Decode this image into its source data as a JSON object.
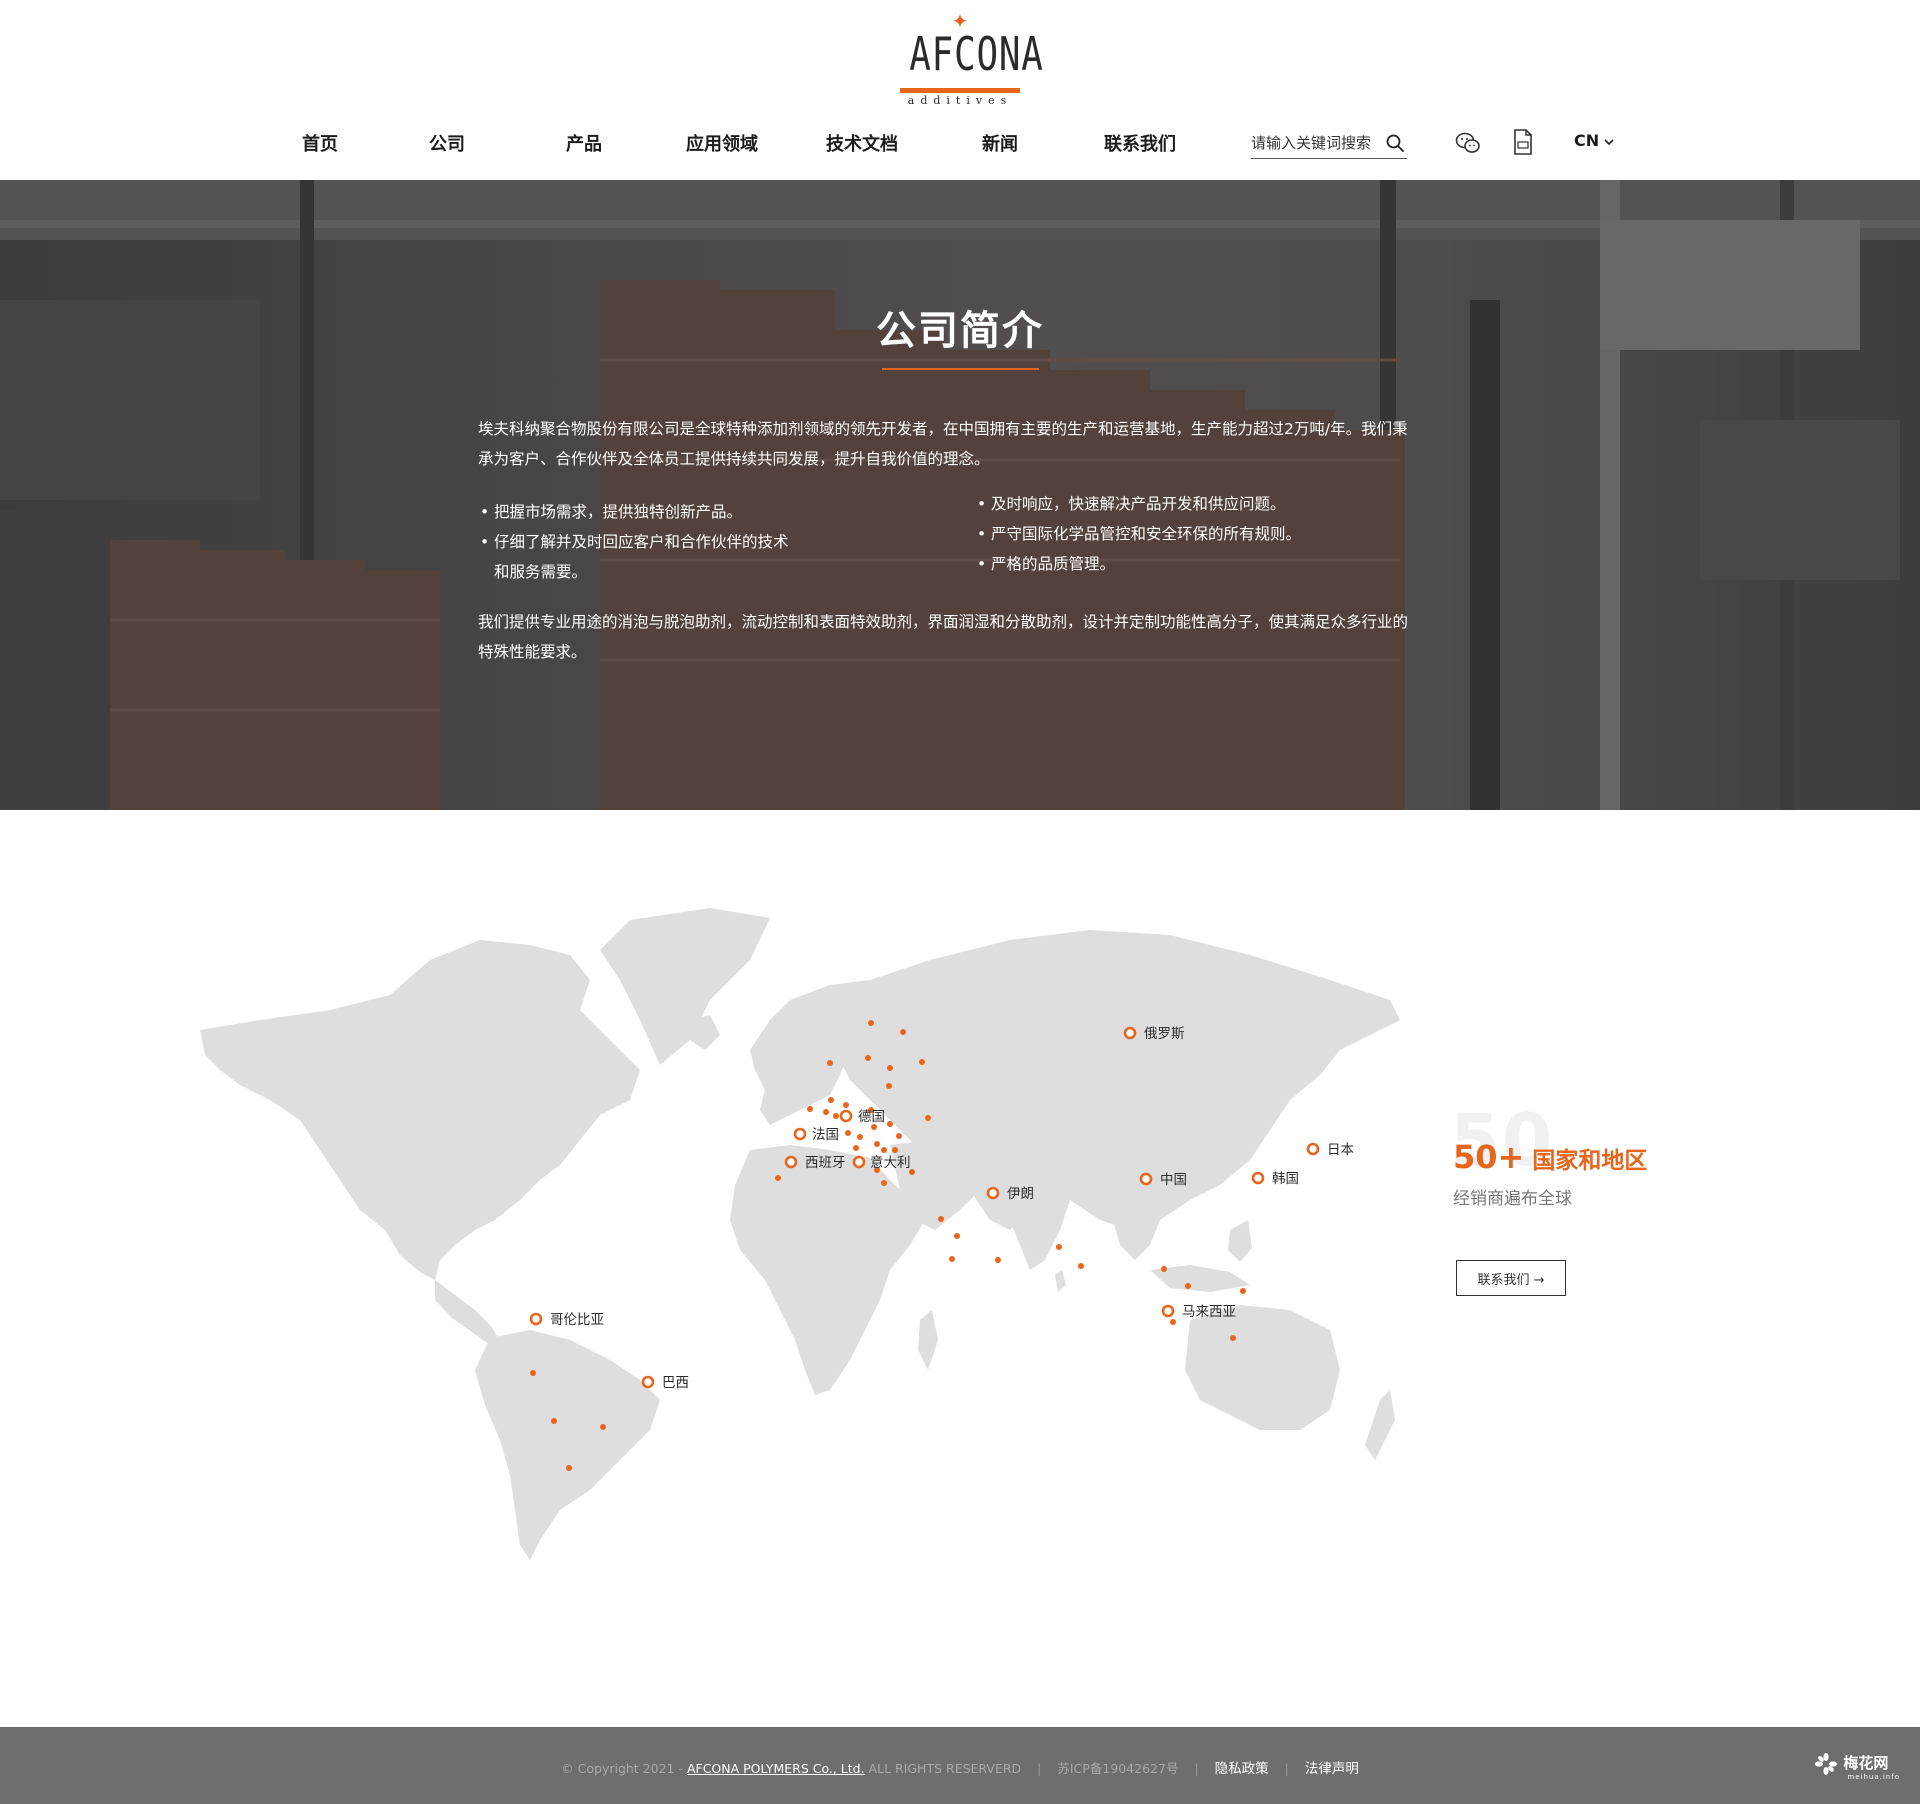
{
  "brand": {
    "logo_word": "AFCONA",
    "logo_sub": "additives",
    "accent": "#e8651c"
  },
  "nav": {
    "items": [
      {
        "label": "首页"
      },
      {
        "label": "公司"
      },
      {
        "label": "产品"
      },
      {
        "label": "应用领域"
      },
      {
        "label": "技术文档"
      },
      {
        "label": "新闻"
      },
      {
        "label": "联系我们"
      }
    ],
    "search_placeholder": "请输入关键词搜索",
    "lang": "CN",
    "icons": [
      "search-icon",
      "wechat-icon",
      "document-icon",
      "chevron-down-icon"
    ]
  },
  "hero": {
    "title": "公司简介",
    "intro_1": "埃夫科纳聚合物股份有限公司是全球特种添加剂领域的领先开发者，在中国拥有主要的生产和运营基地，生产能力超过2万吨/年。我们秉",
    "intro_2": "承为客户、合作伙伴及全体员工提供持续共同发展，提升自我价值的理念。",
    "left_bullets": [
      {
        "line1": "把握市场需求，提供独特创新产品。",
        "line2": ""
      },
      {
        "line1": "仔细了解并及时回应客户和合作伙伴的技术",
        "line2": "和服务需要。"
      }
    ],
    "right_bullets": [
      "及时响应，快速解决产品开发和供应问题。",
      "严守国际化学品管控和安全环保的所有规则。",
      "严格的品质管理。"
    ],
    "outro_1": "我们提供专业用途的消泡与脱泡助剂，流动控制和表面特效助剂，界面润湿和分散助剂，设计并定制功能性高分子，使其满足众多行业的",
    "outro_2": "特殊性能要求。"
  },
  "map": {
    "labels": {
      "russia": "俄罗斯",
      "germany": "德国",
      "france": "法国",
      "spain": "西班牙",
      "italy": "意大利",
      "iran": "伊朗",
      "china": "中国",
      "korea": "韩国",
      "japan": "日本",
      "malaysia": "马来西亚",
      "colombia": "哥伦比亚",
      "brazil": "巴西"
    },
    "stat_ghost": "50",
    "stat_number": "50+",
    "stat_text": "国家和地区",
    "stat_sub": "经销商遍布全球",
    "contact_label": "联系我们 →"
  },
  "footer": {
    "copyright_prefix": "© Copyright 2021 - ",
    "company": "AFCONA POLYMERS Co., Ltd.",
    "rights": " ALL RIGHTS RESERVERD",
    "icp": "苏ICP备19042627号",
    "privacy": "隐私政策",
    "legal": "法律声明"
  },
  "watermark": {
    "name": "梅花网",
    "domain": "meihua.info"
  }
}
